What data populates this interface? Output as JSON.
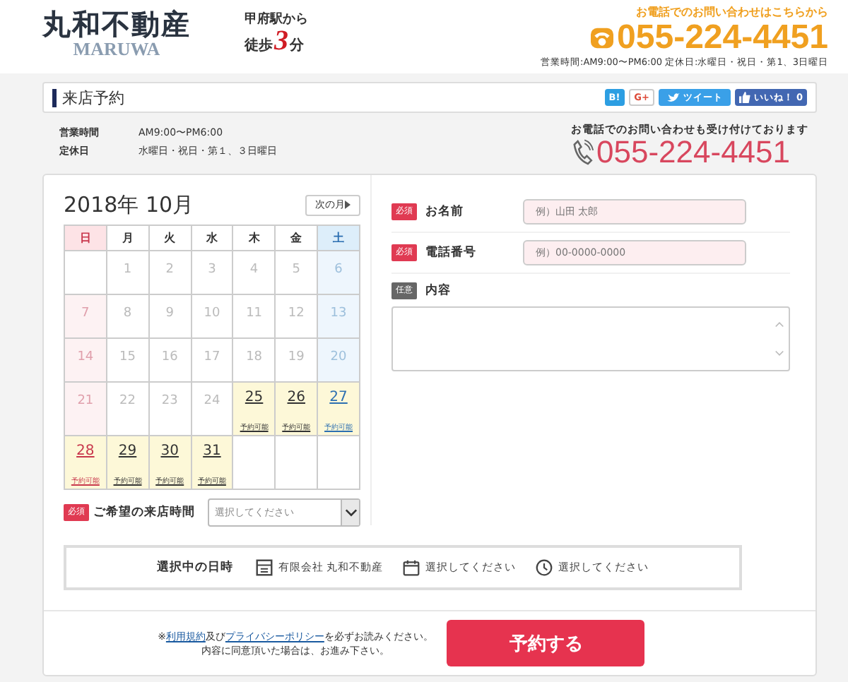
{
  "header": {
    "logo": {
      "name": "丸和不動産",
      "sub": "MARUWA"
    },
    "access": {
      "line1": "甲府駅から",
      "walk": "徒歩",
      "minutes": "3",
      "unit": "分"
    },
    "contact": {
      "caption": "お電話でのお問い合わせはこちらから",
      "phone": "055-224-4451",
      "hours": "営業時間:AM9:00〜PM6:00 定休日:水曜日・祝日・第1、3日曜日"
    }
  },
  "title_bar": {
    "title": "来店予約",
    "share": [
      {
        "kind": "hatena",
        "label": "B!"
      },
      {
        "kind": "google",
        "label": "G+"
      },
      {
        "kind": "tweet",
        "label": "ツイート"
      },
      {
        "kind": "like",
        "label": "いいね！",
        "count": "0"
      }
    ]
  },
  "info": {
    "rows": [
      {
        "label": "営業時間",
        "value": "AM9:00〜PM6:00"
      },
      {
        "label": "定休日",
        "value": "水曜日・祝日・第１、３日曜日"
      }
    ],
    "phone_caption": "お電話でのお問い合わせも受け付けております",
    "phone": "055-224-4451"
  },
  "calendar": {
    "title": "2018年 10月",
    "next_label": "次の月",
    "weekdays": [
      "日",
      "月",
      "火",
      "水",
      "木",
      "金",
      "土"
    ],
    "weeks": [
      [
        {
          "kind": "blank"
        },
        {
          "day": "1",
          "available": false
        },
        {
          "day": "2",
          "available": false
        },
        {
          "day": "3",
          "available": false
        },
        {
          "day": "4",
          "available": false
        },
        {
          "day": "5",
          "available": false
        },
        {
          "day": "6",
          "available": false
        }
      ],
      [
        {
          "day": "7",
          "available": false
        },
        {
          "day": "8",
          "available": false
        },
        {
          "day": "9",
          "available": false
        },
        {
          "day": "10",
          "available": false
        },
        {
          "day": "11",
          "available": false
        },
        {
          "day": "12",
          "available": false
        },
        {
          "day": "13",
          "available": false
        }
      ],
      [
        {
          "day": "14",
          "available": false
        },
        {
          "day": "15",
          "available": false
        },
        {
          "day": "16",
          "available": false
        },
        {
          "day": "17",
          "available": false
        },
        {
          "day": "18",
          "available": false
        },
        {
          "day": "19",
          "available": false
        },
        {
          "day": "20",
          "available": false
        }
      ],
      [
        {
          "day": "21",
          "available": false
        },
        {
          "day": "22",
          "available": false
        },
        {
          "day": "23",
          "available": false
        },
        {
          "day": "24",
          "available": false
        },
        {
          "day": "25",
          "available": true,
          "note": "予約可能"
        },
        {
          "day": "26",
          "available": true,
          "note": "予約可能"
        },
        {
          "day": "27",
          "available": true,
          "note": "予約可能"
        }
      ],
      [
        {
          "day": "28",
          "available": true,
          "note": "予約可能"
        },
        {
          "day": "29",
          "available": true,
          "note": "予約可能"
        },
        {
          "day": "30",
          "available": true,
          "note": "予約可能"
        },
        {
          "day": "31",
          "available": true,
          "note": "予約可能"
        },
        {
          "kind": "blank"
        },
        {
          "kind": "blank"
        },
        {
          "kind": "blank"
        }
      ]
    ]
  },
  "time_select": {
    "badge": "必須",
    "required": true,
    "label": "ご希望の来店時間",
    "placeholder": "選択してください"
  },
  "form": [
    {
      "badge": "必須",
      "required": true,
      "label": "お名前",
      "kind": "input",
      "placeholder": "例）山田 太郎"
    },
    {
      "badge": "必須",
      "required": true,
      "label": "電話番号",
      "kind": "input",
      "placeholder": "例）00-0000-0000"
    },
    {
      "badge": "任意",
      "required": false,
      "label": "内容",
      "kind": "textarea"
    }
  ],
  "summary": {
    "title": "選択中の日時",
    "items": [
      {
        "kind": "building",
        "text": "有限会社 丸和不動産"
      },
      {
        "kind": "calendar",
        "text": "選択してください"
      },
      {
        "kind": "clock",
        "text": "選択してください"
      }
    ]
  },
  "footer": {
    "note": {
      "before": "※",
      "link1": "利用規約",
      "middle": "及び",
      "link2": "プライバシーポリシー",
      "after": "を必ずお読みください。"
    },
    "note2": "内容に同意頂いた場合は、お進み下さい。",
    "button": "予約する"
  }
}
